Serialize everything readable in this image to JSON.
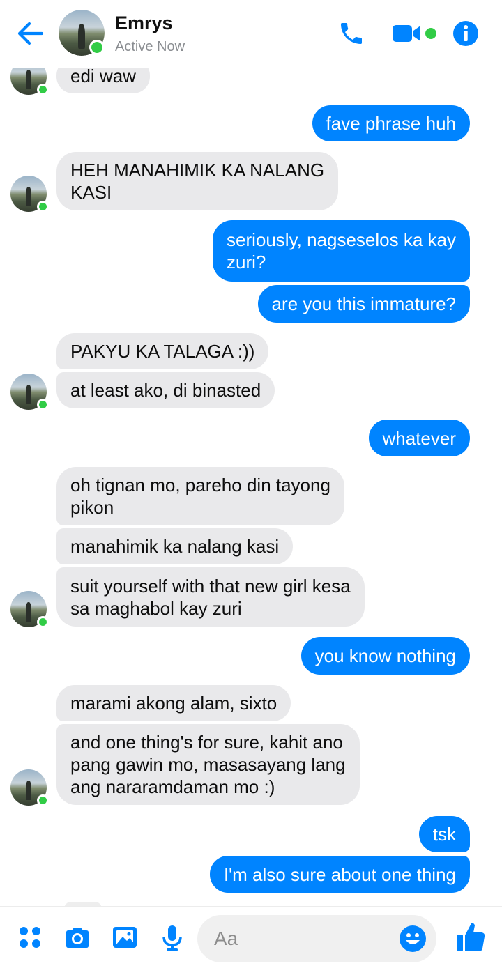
{
  "header": {
    "contact_name": "Emrys",
    "status": "Active Now",
    "icons": [
      "back-arrow-icon",
      "phone-icon",
      "video-camera-icon",
      "info-icon"
    ]
  },
  "colors": {
    "accent": "#0084ff",
    "incoming_bubble": "#e9e9eb",
    "online": "#31cc46"
  },
  "messages": [
    {
      "from": "them",
      "text": "edi waw"
    },
    {
      "from": "me",
      "text": "fave phrase huh"
    },
    {
      "from": "them",
      "text": "HEH MANAHIMIK KA NALANG\nKASI"
    },
    {
      "from": "me",
      "text": "seriously, nagseselos ka kay\nzuri?"
    },
    {
      "from": "me",
      "text": "are you this immature?"
    },
    {
      "from": "them",
      "text": "PAKYU KA TALAGA :))"
    },
    {
      "from": "them",
      "text": "at least ako, di binasted"
    },
    {
      "from": "me",
      "text": "whatever"
    },
    {
      "from": "them",
      "text": "oh tignan mo, pareho din tayong\npikon"
    },
    {
      "from": "them",
      "text": "manahimik ka nalang kasi"
    },
    {
      "from": "them",
      "text": "suit yourself with that new girl kesa\nsa maghabol kay zuri"
    },
    {
      "from": "me",
      "text": "you know nothing"
    },
    {
      "from": "them",
      "text": "marami akong alam, sixto"
    },
    {
      "from": "them",
      "text": "and one thing's for sure, kahit ano\npang gawin mo, masasayang lang\nang nararamdaman mo :)"
    },
    {
      "from": "me",
      "text": "tsk"
    },
    {
      "from": "me",
      "text": "I'm also sure about one thing"
    }
  ],
  "composer": {
    "placeholder": "Aa",
    "icons": [
      "apps-icon",
      "camera-icon",
      "gallery-icon",
      "microphone-icon",
      "emoji-icon",
      "thumbs-up-icon"
    ]
  }
}
